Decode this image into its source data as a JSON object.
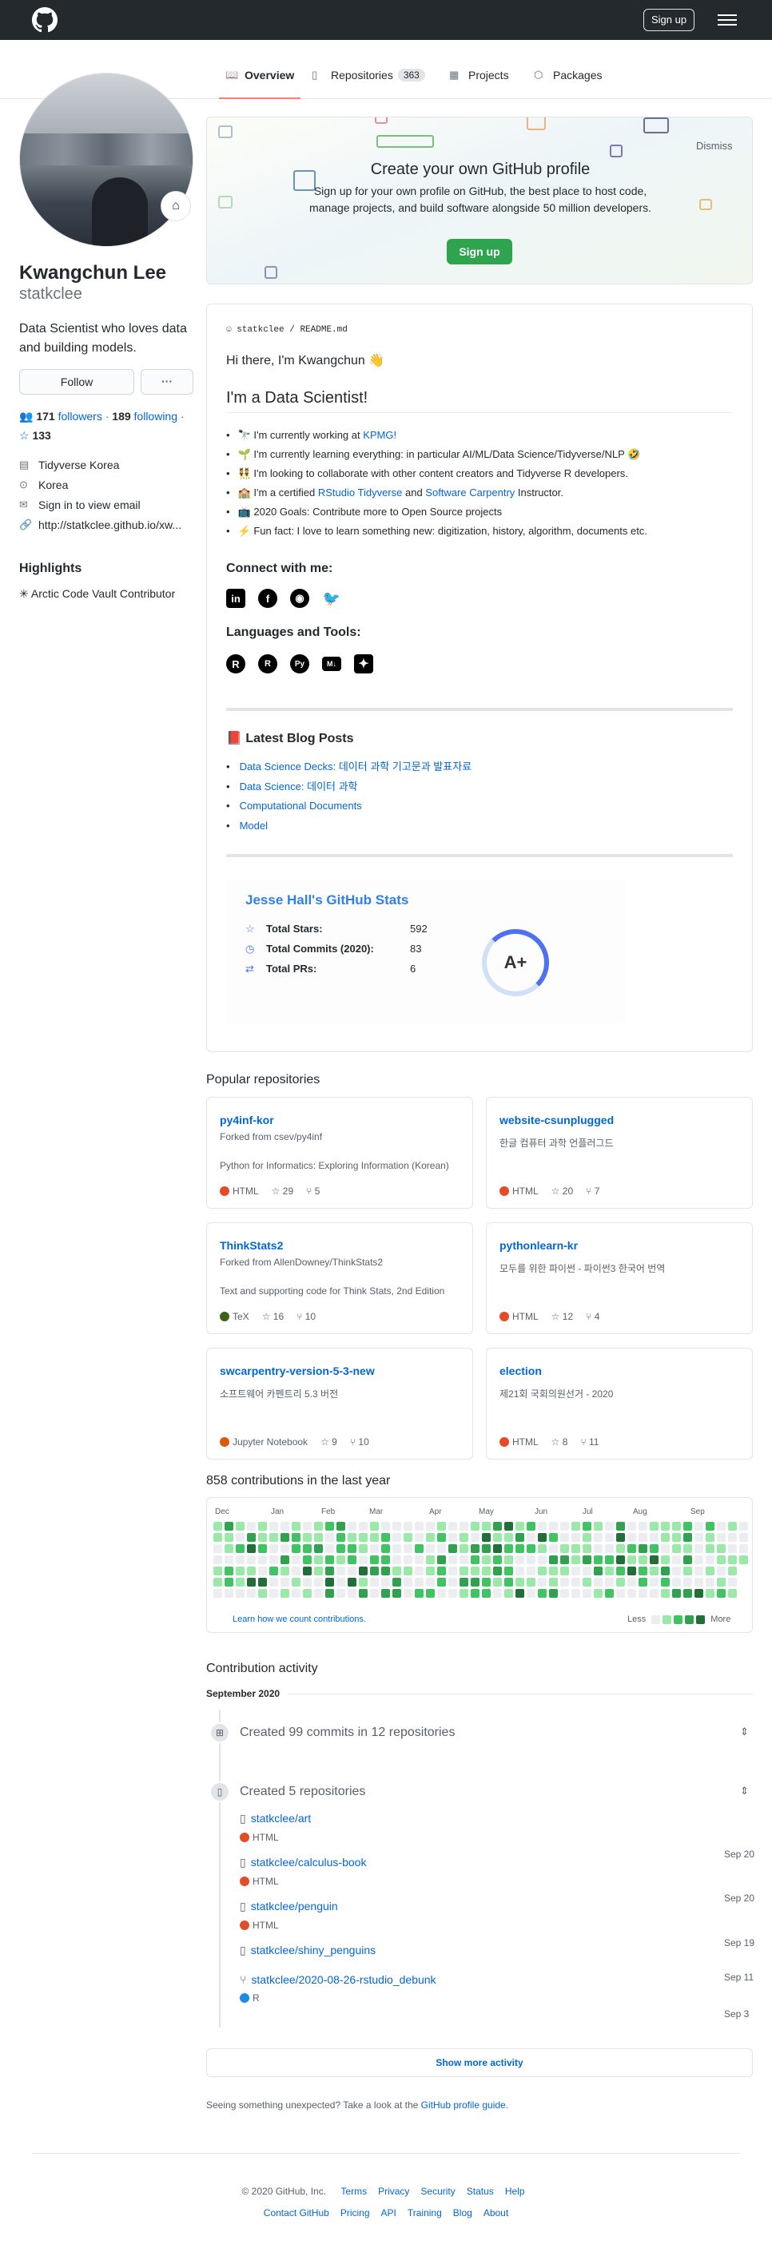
{
  "header": {
    "signup_label": "Sign up",
    "logo": "github-mark-icon",
    "menu": "hamburger-icon"
  },
  "tabs": [
    {
      "label": "Overview",
      "icon": "book-icon"
    },
    {
      "label": "Repositories",
      "count": "363",
      "icon": "repo-icon"
    },
    {
      "label": "Projects",
      "icon": "project-icon"
    },
    {
      "label": "Packages",
      "icon": "package-icon"
    }
  ],
  "profile": {
    "name": "Kwangchun Lee",
    "login": "statkclee",
    "bio": "Data Scientist who loves data and building models.",
    "follow_label": "Follow",
    "more_label": "···",
    "followers_count": "171",
    "followers_label": "followers",
    "following_count": "189",
    "following_label": "following",
    "stars_count": "133",
    "org": "Tidyverse Korea",
    "location": "Korea",
    "email": "Sign in to view email",
    "website": "http://statkclee.github.io/xw...",
    "highlights_title": "Highlights",
    "highlight_item": "Arctic Code Vault Contributor"
  },
  "banner": {
    "title": "Create your own GitHub profile",
    "text": "Sign up for your own profile on GitHub, the best place to host code, manage projects, and build software alongside 50 million developers.",
    "signup_label": "Sign up",
    "dismiss_label": "Dismiss"
  },
  "readme": {
    "owner": "statkclee",
    "sep": "/",
    "file": "README.md",
    "greeting": "Hi there, I'm Kwangchun 👋",
    "heading": "I'm a Data Scientist!",
    "items": [
      {
        "pre": "🔭 I'm currently working at ",
        "link": "KPMG!",
        "post": ""
      },
      {
        "pre": "🌱 I'm currently learning everything: in particular AI/ML/Data Science/Tidyverse/NLP 🤣",
        "link": "",
        "post": ""
      },
      {
        "pre": "👯 I'm looking to collaborate with other content creators and Tidyverse R developers.",
        "link": "",
        "post": ""
      },
      {
        "pre": "🏫 I'm a certified ",
        "link": "RStudio Tidyverse",
        "mid": " and ",
        "link2": "Software Carpentry",
        "post": " Instructor."
      },
      {
        "pre": "📺 2020 Goals: Contribute more to Open Source projects",
        "link": "",
        "post": ""
      },
      {
        "pre": "⚡ Fun fact: I love to learn something new: digitization, history, algorithm, documents etc.",
        "link": "",
        "post": ""
      }
    ],
    "connect_title": "Connect with me:",
    "connect_icons": [
      "in",
      "f",
      "◉",
      "🐦"
    ],
    "tools_title": "Languages and Tools:",
    "tool_icons": [
      "R",
      "R",
      "Py",
      "M↓",
      "✦"
    ],
    "blog_title": "📕 Latest Blog Posts",
    "blog_posts": [
      "Data Science Decks: 데이터 과학 기고문과 발표자료",
      "Data Science: 데이터 과학",
      "Computational Documents",
      "Model"
    ],
    "stats": {
      "title": "Jesse Hall's GitHub Stats",
      "rows": [
        {
          "label": "Total Stars:",
          "value": "592",
          "icon": "☆"
        },
        {
          "label": "Total Commits (2020):",
          "value": "83",
          "icon": "◷"
        },
        {
          "label": "Total PRs:",
          "value": "6",
          "icon": "⇄"
        }
      ],
      "rank": "A+",
      "rank_progress": 0.35
    }
  },
  "popular": {
    "title": "Popular repositories",
    "repos": [
      {
        "name": "py4inf-kor",
        "fork": "Forked from csev/py4inf",
        "desc": "Python for Informatics: Exploring Information (Korean)",
        "lang": "HTML",
        "color": "#e34c26",
        "stars": "29",
        "forks": "5"
      },
      {
        "name": "website-csunplugged",
        "fork": "",
        "desc": "한글 컴퓨터 과학 언플러그드",
        "lang": "HTML",
        "color": "#e34c26",
        "stars": "20",
        "forks": "7"
      },
      {
        "name": "ThinkStats2",
        "fork": "Forked from AllenDowney/ThinkStats2",
        "desc": "Text and supporting code for Think Stats, 2nd Edition",
        "lang": "TeX",
        "color": "#3D6117",
        "stars": "16",
        "forks": "10"
      },
      {
        "name": "pythonlearn-kr",
        "fork": "",
        "desc": "모두를 위한 파이썬 - 파이썬3 한국어 번역",
        "lang": "HTML",
        "color": "#e34c26",
        "stars": "12",
        "forks": "4"
      },
      {
        "name": "swcarpentry-version-5-3-new",
        "fork": "",
        "desc": "소프트웨어 카펜트리 5.3 버전",
        "lang": "Jupyter Notebook",
        "color": "#DA5B0B",
        "stars": "9",
        "forks": "10"
      },
      {
        "name": "election",
        "fork": "",
        "desc": "제21회 국회의원선거 - 2020",
        "lang": "HTML",
        "color": "#e34c26",
        "stars": "8",
        "forks": "11"
      }
    ]
  },
  "contributions": {
    "title": "858 contributions in the last year",
    "months": [
      "Dec",
      "Jan",
      "Feb",
      "Mar",
      "Apr",
      "May",
      "Jun",
      "Jul",
      "Aug",
      "Sep"
    ],
    "learn_label": "Learn how we count contributions.",
    "less_label": "Less",
    "more_label": "More",
    "levels": [
      "#ebedf0",
      "#9be9a8",
      "#40c463",
      "#30a14e",
      "#216e39"
    ]
  },
  "activity": {
    "title": "Contribution activity",
    "month": "September 2020",
    "commits_label": "Created 99 commits in 12 repositories",
    "repos_label": "Created 5 repositories",
    "created": [
      {
        "name": "statkclee/art",
        "lang": "HTML",
        "color": "#e34c26",
        "date": "Sep 20",
        "icon": "repo-icon"
      },
      {
        "name": "statkclee/calculus-book",
        "lang": "HTML",
        "color": "#e34c26",
        "date": "Sep 20",
        "icon": "repo-icon"
      },
      {
        "name": "statkclee/penguin",
        "lang": "HTML",
        "color": "#e34c26",
        "date": "Sep 19",
        "icon": "repo-icon"
      },
      {
        "name": "statkclee/shiny_penguins",
        "lang": "",
        "color": "",
        "date": "Sep 11",
        "icon": "repo-icon"
      },
      {
        "name": "statkclee/2020-08-26-rstudio_debunk",
        "lang": "R",
        "color": "#198CE7",
        "date": "Sep 3",
        "icon": "fork-icon"
      }
    ],
    "show_more": "Show more activity",
    "unexpected_pre": "Seeing something unexpected? Take a look at the ",
    "unexpected_link": "GitHub profile guide",
    "unexpected_post": "."
  },
  "footer": {
    "copyright": "© 2020 GitHub, Inc.",
    "row1": [
      "Terms",
      "Privacy",
      "Security",
      "Status",
      "Help"
    ],
    "row2": [
      "Contact GitHub",
      "Pricing",
      "API",
      "Training",
      "Blog",
      "About"
    ]
  }
}
